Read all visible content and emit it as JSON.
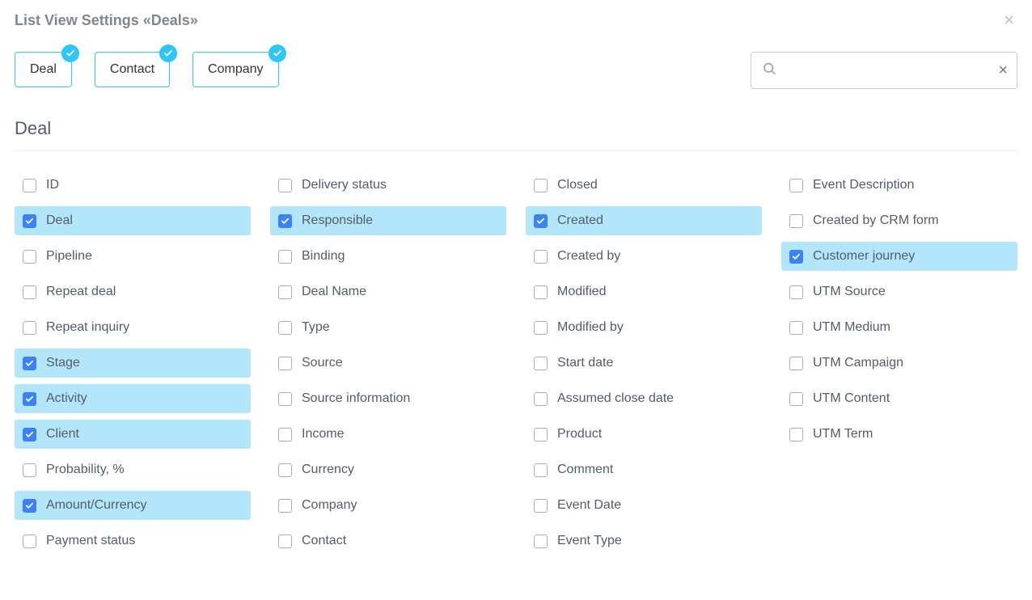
{
  "dialog": {
    "title": "List View Settings «Deals»"
  },
  "tabs": [
    {
      "label": "Deal",
      "checked": true
    },
    {
      "label": "Contact",
      "checked": true
    },
    {
      "label": "Company",
      "checked": true
    }
  ],
  "search": {
    "value": "",
    "placeholder": ""
  },
  "section": {
    "title": "Deal"
  },
  "columns": [
    [
      {
        "label": "ID",
        "checked": false
      },
      {
        "label": "Deal",
        "checked": true
      },
      {
        "label": "Pipeline",
        "checked": false
      },
      {
        "label": "Repeat deal",
        "checked": false
      },
      {
        "label": "Repeat inquiry",
        "checked": false
      },
      {
        "label": "Stage",
        "checked": true
      },
      {
        "label": "Activity",
        "checked": true
      },
      {
        "label": "Client",
        "checked": true
      },
      {
        "label": "Probability, %",
        "checked": false
      },
      {
        "label": "Amount/Currency",
        "checked": true
      },
      {
        "label": "Payment status",
        "checked": false
      }
    ],
    [
      {
        "label": "Delivery status",
        "checked": false
      },
      {
        "label": "Responsible",
        "checked": true
      },
      {
        "label": "Binding",
        "checked": false
      },
      {
        "label": "Deal Name",
        "checked": false
      },
      {
        "label": "Type",
        "checked": false
      },
      {
        "label": "Source",
        "checked": false
      },
      {
        "label": "Source information",
        "checked": false
      },
      {
        "label": "Income",
        "checked": false
      },
      {
        "label": "Currency",
        "checked": false
      },
      {
        "label": "Company",
        "checked": false
      },
      {
        "label": "Contact",
        "checked": false
      }
    ],
    [
      {
        "label": "Closed",
        "checked": false
      },
      {
        "label": "Created",
        "checked": true
      },
      {
        "label": "Created by",
        "checked": false
      },
      {
        "label": "Modified",
        "checked": false
      },
      {
        "label": "Modified by",
        "checked": false
      },
      {
        "label": "Start date",
        "checked": false
      },
      {
        "label": "Assumed close date",
        "checked": false
      },
      {
        "label": "Product",
        "checked": false
      },
      {
        "label": "Comment",
        "checked": false
      },
      {
        "label": "Event Date",
        "checked": false
      },
      {
        "label": "Event Type",
        "checked": false
      }
    ],
    [
      {
        "label": "Event Description",
        "checked": false
      },
      {
        "label": "Created by CRM form",
        "checked": false
      },
      {
        "label": "Customer journey",
        "checked": true
      },
      {
        "label": "UTM Source",
        "checked": false
      },
      {
        "label": "UTM Medium",
        "checked": false
      },
      {
        "label": "UTM Campaign",
        "checked": false
      },
      {
        "label": "UTM Content",
        "checked": false
      },
      {
        "label": "UTM Term",
        "checked": false
      }
    ]
  ]
}
